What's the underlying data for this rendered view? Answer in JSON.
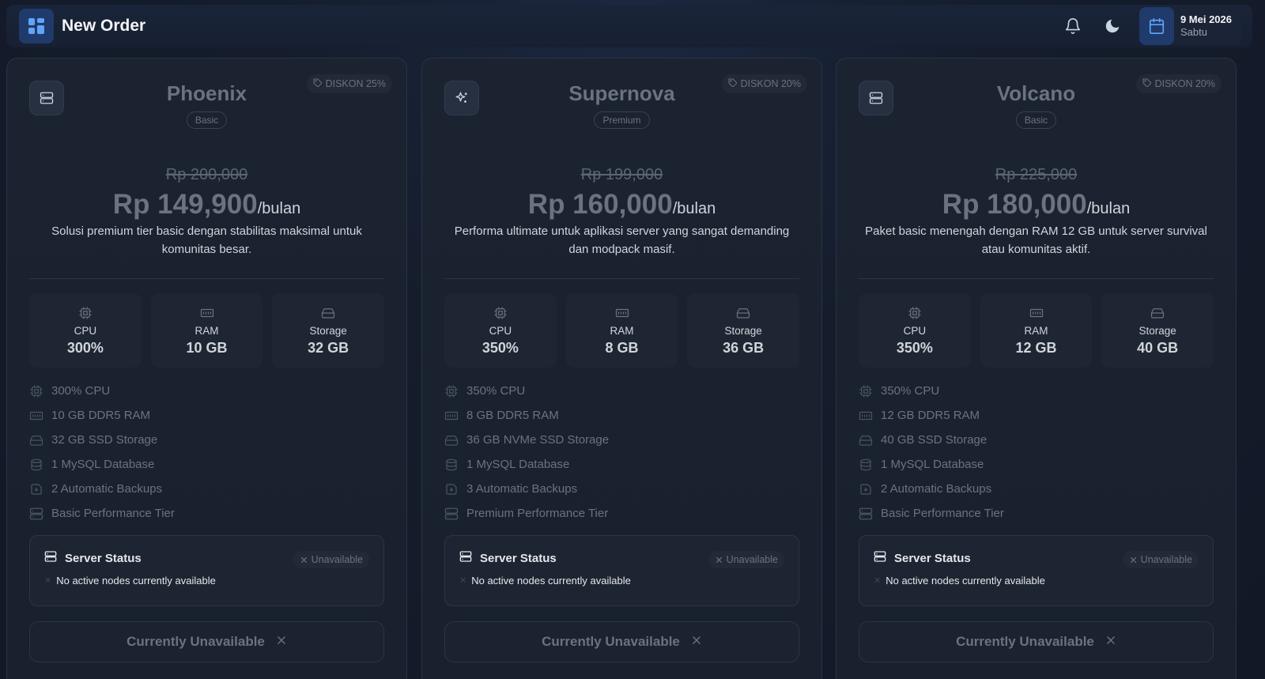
{
  "header": {
    "title": "New Order",
    "app_icon": "grid-icon",
    "notification_icon": "bell-icon",
    "theme_icon": "moon-icon",
    "date": {
      "icon": "calendar-icon",
      "main": "9 Mei 2026",
      "sub": "Sabtu"
    }
  },
  "colors": {
    "accent": "#3b82f6",
    "card_bg": "#1b2230",
    "muted": "#6b7280"
  },
  "plans": [
    {
      "icon": "server-icon",
      "name": "Phoenix",
      "tier": "Basic",
      "discount": "DISKON 25%",
      "old_price": "Rp 200,000",
      "price": "Rp 149,900",
      "per": "/bulan",
      "description": "Solusi premium tier basic dengan stabilitas maksimal untuk komunitas besar.",
      "specs": [
        {
          "icon": "cpu-icon",
          "label": "CPU",
          "value": "300%"
        },
        {
          "icon": "ram-icon",
          "label": "RAM",
          "value": "10 GB"
        },
        {
          "icon": "storage-icon",
          "label": "Storage",
          "value": "32 GB"
        }
      ],
      "features": [
        {
          "icon": "cpu-icon",
          "text": "300% CPU"
        },
        {
          "icon": "ram-icon",
          "text": "10 GB DDR5 RAM"
        },
        {
          "icon": "storage-icon",
          "text": "32 GB SSD Storage"
        },
        {
          "icon": "database-icon",
          "text": "1 MySQL Database"
        },
        {
          "icon": "backup-icon",
          "text": "2 Automatic Backups"
        },
        {
          "icon": "server-icon",
          "text": "Basic Performance Tier"
        }
      ],
      "status": {
        "title": "Server Status",
        "pill": "Unavailable",
        "message": "No active nodes currently available"
      },
      "cta": "Currently Unavailable"
    },
    {
      "icon": "sparkles-icon",
      "name": "Supernova",
      "tier": "Premium",
      "discount": "DISKON 20%",
      "old_price": "Rp 199,000",
      "price": "Rp 160,000",
      "per": "/bulan",
      "description": "Performa ultimate untuk aplikasi server yang sangat demanding dan modpack masif.",
      "specs": [
        {
          "icon": "cpu-icon",
          "label": "CPU",
          "value": "350%"
        },
        {
          "icon": "ram-icon",
          "label": "RAM",
          "value": "8 GB"
        },
        {
          "icon": "storage-icon",
          "label": "Storage",
          "value": "36 GB"
        }
      ],
      "features": [
        {
          "icon": "cpu-icon",
          "text": "350% CPU"
        },
        {
          "icon": "ram-icon",
          "text": "8 GB DDR5 RAM"
        },
        {
          "icon": "storage-icon",
          "text": "36 GB NVMe SSD Storage"
        },
        {
          "icon": "database-icon",
          "text": "1 MySQL Database"
        },
        {
          "icon": "backup-icon",
          "text": "3 Automatic Backups"
        },
        {
          "icon": "server-icon",
          "text": "Premium Performance Tier"
        }
      ],
      "status": {
        "title": "Server Status",
        "pill": "Unavailable",
        "message": "No active nodes currently available"
      },
      "cta": "Currently Unavailable"
    },
    {
      "icon": "server-icon",
      "name": "Volcano",
      "tier": "Basic",
      "discount": "DISKON 20%",
      "old_price": "Rp 225,000",
      "price": "Rp 180,000",
      "per": "/bulan",
      "description": "Paket basic menengah dengan RAM 12 GB untuk server survival atau komunitas aktif.",
      "specs": [
        {
          "icon": "cpu-icon",
          "label": "CPU",
          "value": "350%"
        },
        {
          "icon": "ram-icon",
          "label": "RAM",
          "value": "12 GB"
        },
        {
          "icon": "storage-icon",
          "label": "Storage",
          "value": "40 GB"
        }
      ],
      "features": [
        {
          "icon": "cpu-icon",
          "text": "350% CPU"
        },
        {
          "icon": "ram-icon",
          "text": "12 GB DDR5 RAM"
        },
        {
          "icon": "storage-icon",
          "text": "40 GB SSD Storage"
        },
        {
          "icon": "database-icon",
          "text": "1 MySQL Database"
        },
        {
          "icon": "backup-icon",
          "text": "2 Automatic Backups"
        },
        {
          "icon": "server-icon",
          "text": "Basic Performance Tier"
        }
      ],
      "status": {
        "title": "Server Status",
        "pill": "Unavailable",
        "message": "No active nodes currently available"
      },
      "cta": "Currently Unavailable"
    }
  ]
}
